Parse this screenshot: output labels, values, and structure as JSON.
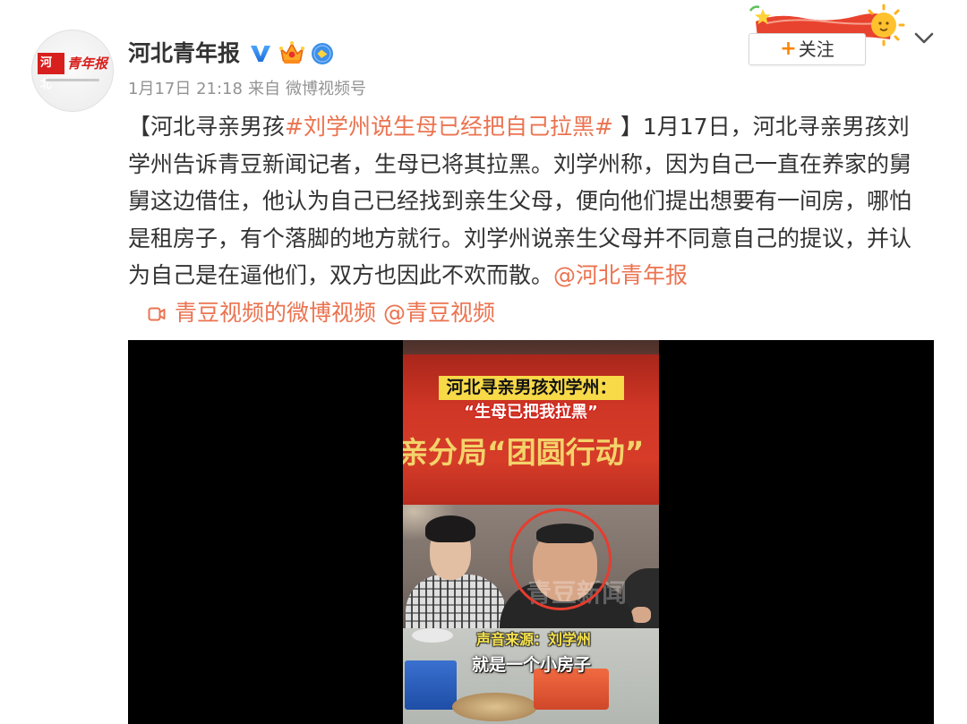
{
  "post": {
    "author": {
      "name": "河北青年报",
      "avatar_logo": {
        "brand_mark": "河北",
        "brand_name": "青年报"
      },
      "badges": {
        "verified": "verified-v-icon",
        "member": "crown-badge-icon",
        "honor": "honor-circle-icon"
      }
    },
    "meta": {
      "time": "1月17日 21:18",
      "from_label": "来自",
      "source": "微博视频号"
    },
    "follow": {
      "plus": "+",
      "label": "关注"
    },
    "menu_icon": "chevron-down-icon",
    "content": [
      {
        "type": "text",
        "text": "【河北寻亲男孩"
      },
      {
        "type": "hashtag",
        "text": "#刘学州说生母已经把自己拉黑#"
      },
      {
        "type": "text",
        "text": " 】1月17日，河北寻亲男孩刘学州告诉青豆新闻记者，生母已将其拉黑。刘学州称，因为自己一直在养家的舅舅这边借住，他认为自己已经找到亲生父母，便向他们提出想要有一间房，哪怕是租房子，有个落脚的地方就行。刘学州说亲生父母并不同意自己的提议，并认为自己是在逼他们，双方也因此不欢而散。"
      },
      {
        "type": "mention",
        "text": "@河北青年报"
      },
      {
        "type": "link",
        "text": "青豆视频的微博视频",
        "icon": "video-link-icon"
      },
      {
        "type": "mention",
        "text": "@青豆视频"
      }
    ],
    "video": {
      "banner_text": "亲分局“团圆行动”",
      "caption_title": "河北寻亲男孩刘学州：",
      "caption_quote": "“生母已把我拉黑”",
      "watermark": "青豆新闻",
      "subtitle_source": "声音来源：刘学州",
      "subtitle_line": "就是一个小房子"
    }
  },
  "colors": {
    "text": "#333333",
    "link": "#eb7350",
    "meta": "#939393",
    "follow_plus": "#ff8200",
    "verified": "#2b83ea",
    "video_bg": "#000000",
    "highlight_circle": "#e53d2f"
  }
}
